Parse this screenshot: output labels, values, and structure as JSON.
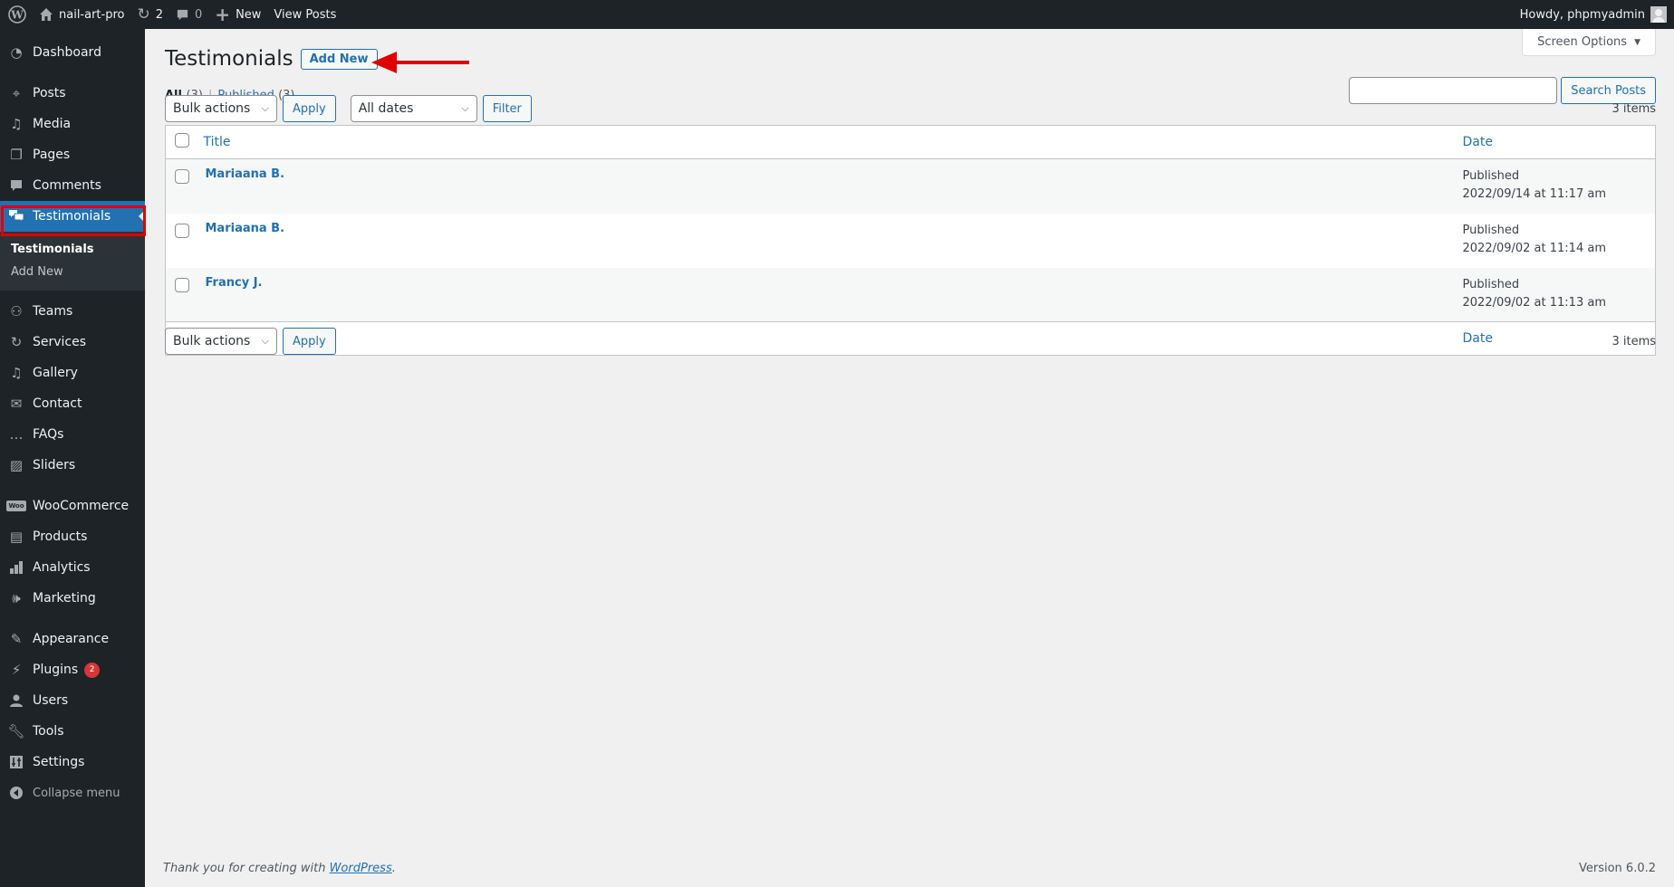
{
  "adminbar": {
    "site_name": "nail-art-pro",
    "updates_count": "2",
    "comments_count": "0",
    "new_label": "New",
    "view_posts_label": "View Posts",
    "greeting": "Howdy, phpmyadmin"
  },
  "sidebar": {
    "items": [
      {
        "label": "Dashboard",
        "icon": "dashboard-icon"
      },
      {
        "label": "Posts",
        "icon": "pin-icon"
      },
      {
        "label": "Media",
        "icon": "media-icon"
      },
      {
        "label": "Pages",
        "icon": "pages-icon"
      },
      {
        "label": "Comments",
        "icon": "comment-icon"
      },
      {
        "label": "Testimonials",
        "icon": "testimonial-icon"
      },
      {
        "label": "Teams",
        "icon": "groups-icon"
      },
      {
        "label": "Services",
        "icon": "update-icon"
      },
      {
        "label": "Gallery",
        "icon": "media-icon"
      },
      {
        "label": "Contact",
        "icon": "email-icon"
      },
      {
        "label": "FAQs",
        "icon": "format-chat-icon"
      },
      {
        "label": "Sliders",
        "icon": "images-icon"
      },
      {
        "label": "WooCommerce",
        "icon": "woo-icon"
      },
      {
        "label": "Products",
        "icon": "archive-icon"
      },
      {
        "label": "Analytics",
        "icon": "chart-bar-icon"
      },
      {
        "label": "Marketing",
        "icon": "megaphone-icon"
      },
      {
        "label": "Appearance",
        "icon": "paintbrush-icon"
      },
      {
        "label": "Plugins",
        "icon": "plugin-icon",
        "badge": "2"
      },
      {
        "label": "Users",
        "icon": "user-icon"
      },
      {
        "label": "Tools",
        "icon": "wrench-icon"
      },
      {
        "label": "Settings",
        "icon": "settings-icon"
      }
    ],
    "submenu": [
      {
        "label": "Testimonials"
      },
      {
        "label": "Add New"
      }
    ],
    "collapse_label": "Collapse menu"
  },
  "screen_options": {
    "label": "Screen Options"
  },
  "page": {
    "title": "Testimonials",
    "add_new_label": "Add New"
  },
  "views": {
    "all_label": "All",
    "all_count": "(3)",
    "published_label": "Published",
    "published_count": "(3)"
  },
  "search": {
    "value": "",
    "button_label": "Search Posts"
  },
  "tablenav_top": {
    "bulk_actions": "Bulk actions",
    "apply_label": "Apply",
    "dates_filter": "All dates",
    "filter_label": "Filter",
    "items_count": "3 items"
  },
  "tablenav_bottom": {
    "bulk_actions": "Bulk actions",
    "apply_label": "Apply",
    "items_count": "3 items"
  },
  "table": {
    "columns": {
      "title": "Title",
      "date": "Date"
    },
    "rows": [
      {
        "title": "Mariaana B.",
        "status": "Published",
        "date": "2022/09/14 at 11:17 am"
      },
      {
        "title": "Mariaana B.",
        "status": "Published",
        "date": "2022/09/02 at 11:14 am"
      },
      {
        "title": "Francy J.",
        "status": "Published",
        "date": "2022/09/02 at 11:13 am"
      }
    ]
  },
  "footer": {
    "thanks_prefix": "Thank you for creating with ",
    "wordpress_link": "WordPress",
    "thanks_suffix": ".",
    "version": "Version 6.0.2"
  },
  "colors": {
    "admin_bar_bg": "#1d2327",
    "accent": "#2271b1",
    "annotation_red": "#e00000",
    "badge_red": "#d63638"
  }
}
